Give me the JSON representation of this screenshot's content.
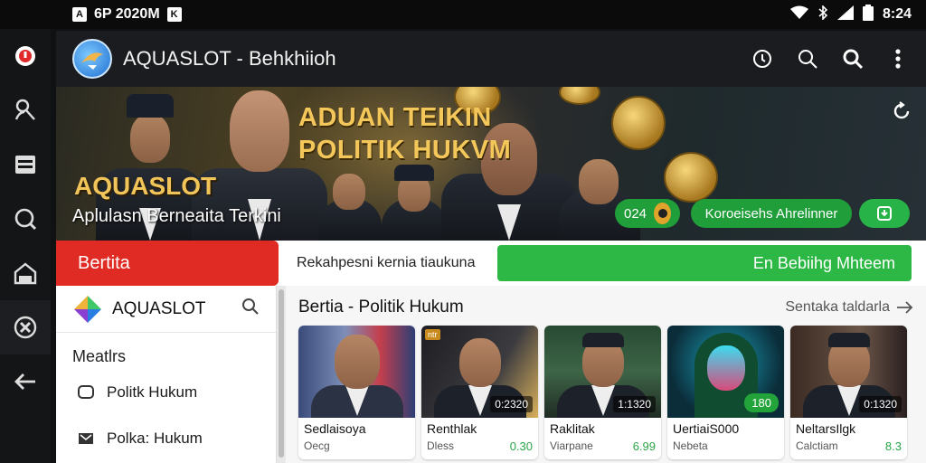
{
  "status_bar": {
    "left_text": "6P 2020M",
    "time": "8:24"
  },
  "rail": {
    "items": [
      "notification",
      "person",
      "article",
      "chat",
      "home",
      "games",
      "back"
    ]
  },
  "app_bar": {
    "title": "AQUASLOT - Behkhiioh",
    "actions": [
      "info-icon",
      "search-icon",
      "search-icon",
      "more-vertical-icon"
    ]
  },
  "hero": {
    "headline_line1": "ADUAN TEIKIN",
    "headline_line2": "POLITIK HUKVM",
    "brand": "AQUASLOT",
    "subtitle": "Aplulasn Berneaita  Terkini",
    "count": "024",
    "subscribe_label": "Koroeisehs Ahrelinner",
    "colors": {
      "brand_gold": "#f2c55b",
      "accent_green": "#1f9e3a"
    }
  },
  "tabs": {
    "active_label": "Bertita",
    "description": "Rekahpesni kernia tiaukuna",
    "cta_label": "En Bebiihg Mhteem",
    "colors": {
      "active": "#e02b24",
      "cta": "#2db845"
    }
  },
  "drawer": {
    "brand": "AQUASLOT",
    "section_label": "Meatlrs",
    "items": [
      {
        "label": "Politk Hukum",
        "icon": "chat-bubble-icon"
      },
      {
        "label": "Polka: Hukum",
        "icon": "mail-icon"
      }
    ]
  },
  "main": {
    "title": "Bertia - Politik Hukum",
    "see_all": "Sentaka taldarla",
    "cards": [
      {
        "title": "Sedlaisoya",
        "source": "Oecg",
        "number": "",
        "badge": ""
      },
      {
        "title": "Renthlak",
        "source": "Dless",
        "number": "0.30",
        "badge": "0:2320",
        "tag": "ntr"
      },
      {
        "title": "Raklitak",
        "source": "Viarpane",
        "number": "6.99",
        "badge": "1:1320"
      },
      {
        "title": "UertiaiS000",
        "source": "Nebeta",
        "number": "",
        "badge": "180"
      },
      {
        "title": "NeltarsIlgk",
        "source": "Calctiam",
        "number": "8.3",
        "badge": "0:1320"
      }
    ]
  }
}
